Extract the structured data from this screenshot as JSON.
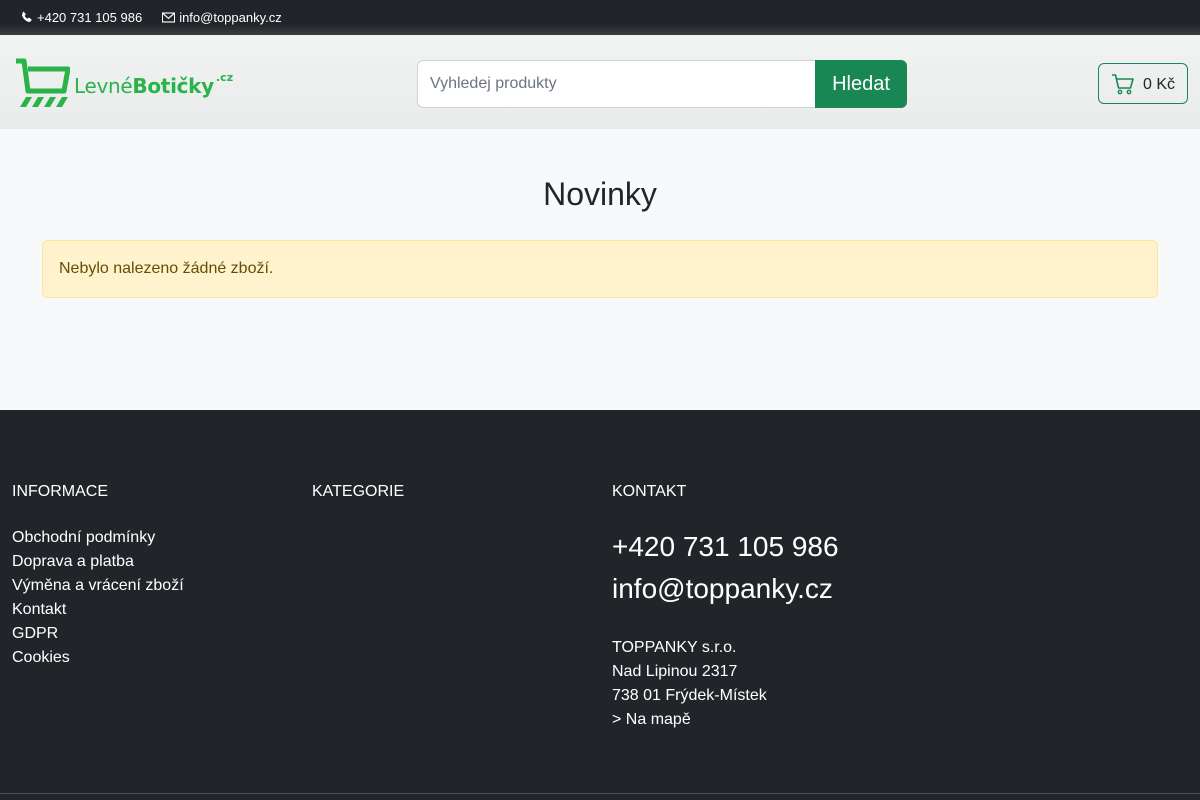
{
  "topbar": {
    "phone": "+420 731 105 986",
    "email": "info@toppanky.cz"
  },
  "header": {
    "logo": {
      "part1": "Levné",
      "part2": "Botičky",
      "suffix": ".cz"
    },
    "search": {
      "placeholder": "Vyhledej produkty",
      "value": "",
      "button": "Hledat"
    },
    "cart": {
      "total": "0 Kč",
      "icon": "cart-icon"
    }
  },
  "main": {
    "title": "Novinky",
    "alert": "Nebylo nalezeno žádné zboží."
  },
  "footer": {
    "info": {
      "heading": "INFORMACE",
      "links": [
        "Obchodní podmínky",
        "Doprava a platba",
        "Výměna a vrácení zboží",
        "Kontakt",
        "GDPR",
        "Cookies"
      ]
    },
    "categories": {
      "heading": "KATEGORIE"
    },
    "contact": {
      "heading": "KONTAKT",
      "phone": "+420 731 105 986",
      "email": "info@toppanky.cz",
      "company": "TOPPANKY s.r.o.",
      "street": "Nad Lipinou 2317",
      "city": "738 01 Frýdek-Místek",
      "map": "> Na mapě"
    }
  },
  "colors": {
    "primary": "#198754",
    "logo_green": "#2ab24b",
    "dark": "#212529",
    "alert_bg": "#fff3cd"
  }
}
